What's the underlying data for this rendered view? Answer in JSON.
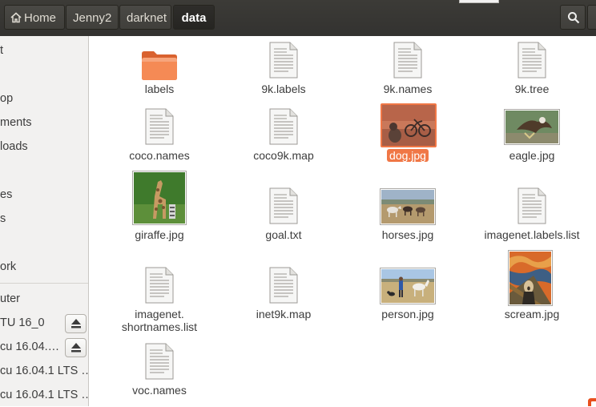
{
  "header": {
    "breadcrumbs": [
      "Home",
      "Jenny2",
      "darknet",
      "data"
    ],
    "active_crumb": "data"
  },
  "sidebar": {
    "items": [
      {
        "label": "t",
        "name": "sidebar-item-recent"
      },
      {
        "label": "",
        "name": "sidebar-item-home"
      },
      {
        "label": "op",
        "name": "sidebar-item-desktop"
      },
      {
        "label": "ments",
        "name": "sidebar-item-documents"
      },
      {
        "label": "loads",
        "name": "sidebar-item-downloads"
      },
      {
        "label": "",
        "name": "sidebar-item-music"
      },
      {
        "label": "es",
        "name": "sidebar-item-pictures"
      },
      {
        "label": "s",
        "name": "sidebar-item-videos"
      },
      {
        "label": "",
        "name": "sidebar-item-trash"
      },
      {
        "label": "ork",
        "name": "sidebar-item-network"
      },
      {
        "label": "uter",
        "name": "sidebar-item-computer"
      },
      {
        "label": "TU 16_0",
        "name": "sidebar-item-drive-1"
      },
      {
        "label": "cu 16.04.…",
        "name": "sidebar-item-drive-2"
      },
      {
        "label": "cu 16.04.1 LTS …",
        "name": "sidebar-item-drive-3"
      },
      {
        "label": "cu 16.04.1 LTS …",
        "name": "sidebar-item-drive-4"
      }
    ]
  },
  "files": [
    {
      "name": "labels",
      "kind": "folder"
    },
    {
      "name": "9k.labels",
      "kind": "text"
    },
    {
      "name": "9k.names",
      "kind": "text"
    },
    {
      "name": "9k.tree",
      "kind": "text"
    },
    {
      "name": "coco.names",
      "kind": "text"
    },
    {
      "name": "coco9k.map",
      "kind": "text"
    },
    {
      "name": "dog.jpg",
      "kind": "image",
      "selected": true
    },
    {
      "name": "eagle.jpg",
      "kind": "image"
    },
    {
      "name": "giraffe.jpg",
      "kind": "image"
    },
    {
      "name": "goal.txt",
      "kind": "text"
    },
    {
      "name": "horses.jpg",
      "kind": "image"
    },
    {
      "name": "imagenet.labels.list",
      "kind": "text"
    },
    {
      "name": "imagenet.\nshortnames.list",
      "kind": "text"
    },
    {
      "name": "inet9k.map",
      "kind": "text"
    },
    {
      "name": "person.jpg",
      "kind": "image"
    },
    {
      "name": "scream.jpg",
      "kind": "image"
    },
    {
      "name": "voc.names",
      "kind": "text"
    }
  ],
  "colors": {
    "accent": "#f07746",
    "header_bg": "#3c3b37",
    "sidebar_bg": "#f2f1f0",
    "folder": "#f07746"
  }
}
